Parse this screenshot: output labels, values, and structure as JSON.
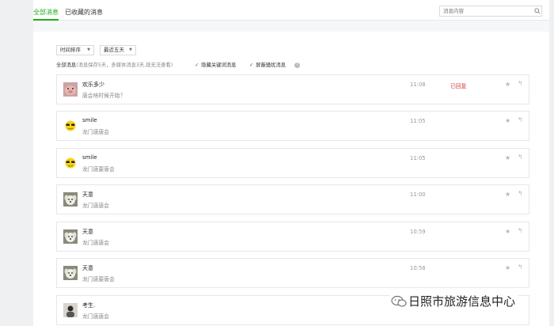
{
  "tabs": [
    {
      "label": "全部消息",
      "active": true
    },
    {
      "label": "已收藏的消息",
      "active": false
    }
  ],
  "search": {
    "placeholder": "消息内容"
  },
  "filters": {
    "sort_label": "时间排序",
    "range_label": "最近五天"
  },
  "info": {
    "title": "全部消息",
    "note": "(消息保存5天，多媒体消息3天,现无法查看)",
    "hide_keyword": "隐藏关键词消息",
    "block_harass": "屏蔽骚扰消息"
  },
  "messages": [
    {
      "sender": "欢乐多少",
      "content": "唐会啥时候开始？",
      "time": "11:08",
      "status": "已回复",
      "avatar": "pig-avatar"
    },
    {
      "sender": "smile",
      "content": "龙门唐唐会",
      "time": "11:05",
      "status": "",
      "avatar": "sunglasses-emoji-avatar"
    },
    {
      "sender": "smile",
      "content": "龙门唐要唐会",
      "time": "11:05",
      "status": "",
      "avatar": "sunglasses-emoji-avatar"
    },
    {
      "sender": "天意",
      "content": "龙门唐唐会",
      "time": "11:00",
      "status": "",
      "avatar": "dog-avatar"
    },
    {
      "sender": "天意",
      "content": "龙门唐唐会",
      "time": "10:59",
      "status": "",
      "avatar": "dog-avatar"
    },
    {
      "sender": "天意",
      "content": "龙门唐要唐会",
      "time": "10:58",
      "status": "",
      "avatar": "dog-avatar"
    },
    {
      "sender": "考生.",
      "content": "龙门唐唐会",
      "time": "",
      "status": "",
      "avatar": "photo-avatar"
    }
  ],
  "watermark": {
    "text": "日照市旅游信息中心"
  },
  "colors": {
    "accent": "#1aad19",
    "replied": "#d84040"
  }
}
